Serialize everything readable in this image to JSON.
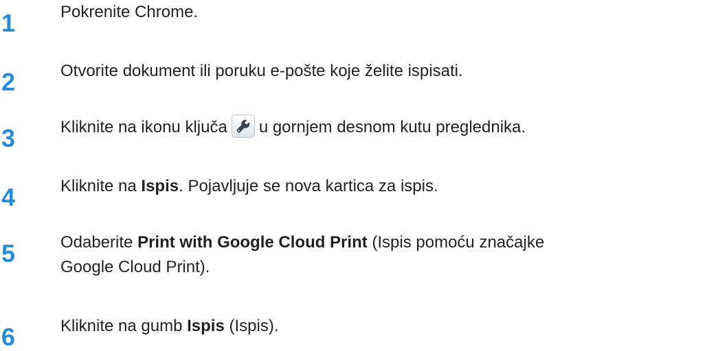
{
  "accent_color": "#2a8dd4",
  "steps": [
    {
      "number": "1",
      "text": "Pokrenite Chrome."
    },
    {
      "number": "2",
      "text": "Otvorite dokument ili poruku e-pošte koje želite ispisati."
    },
    {
      "number": "3",
      "text_before": "Kliknite na ikonu ključa",
      "icon": "wrench-icon",
      "text_after": "u gornjem desnom kutu preglednika."
    },
    {
      "number": "4",
      "text_before": "Kliknite na ",
      "bold": "Ispis",
      "text_after": ". Pojavljuje se nova kartica za ispis."
    },
    {
      "number": "5",
      "text_before": "Odaberite ",
      "bold": "Print with Google Cloud Print",
      "text_after": " (Ispis pomoću značajke",
      "text_line2": "Google Cloud Print)."
    },
    {
      "number": "6",
      "text_before": "Kliknite na gumb ",
      "bold": "Ispis",
      "text_after": " (Ispis)."
    }
  ]
}
